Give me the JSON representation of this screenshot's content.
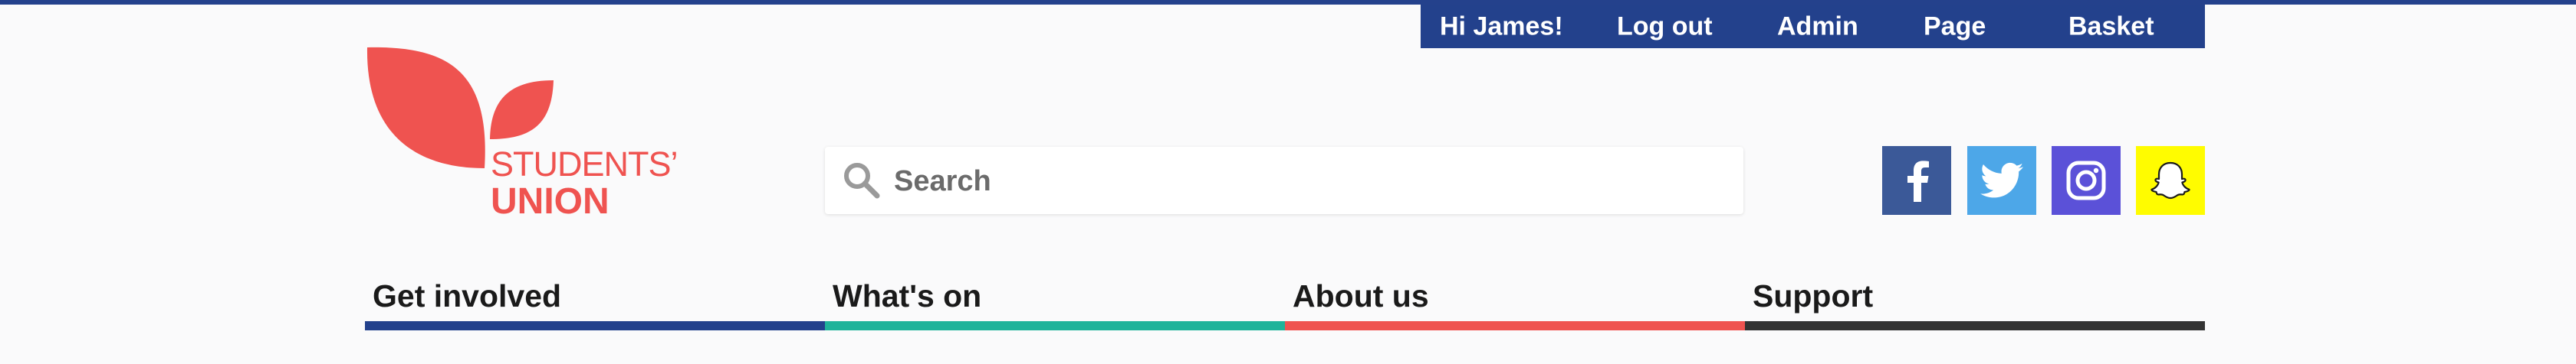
{
  "user_bar": {
    "greeting": "Hi James!",
    "logout": "Log out",
    "admin": "Admin",
    "page": "Page",
    "basket": "Basket"
  },
  "logo": {
    "line1": "STUDENTS’",
    "line2": "UNION",
    "color": "#ef5350"
  },
  "search": {
    "placeholder": "Search",
    "icon": "search-icon"
  },
  "social": [
    {
      "name": "facebook-icon",
      "color": "#3b5998"
    },
    {
      "name": "twitter-icon",
      "color": "#4da7e8"
    },
    {
      "name": "instagram-icon",
      "color": "#5b51d8"
    },
    {
      "name": "snapchat-icon",
      "color": "#fffc00"
    }
  ],
  "nav": {
    "items": [
      {
        "label": "Get involved",
        "color": "#23418c"
      },
      {
        "label": "What's on",
        "color": "#1fb39a"
      },
      {
        "label": "About us",
        "color": "#ef5350"
      },
      {
        "label": "Support",
        "color": "#333333"
      }
    ]
  },
  "colors": {
    "primary": "#23418c",
    "background": "#fafafb"
  }
}
